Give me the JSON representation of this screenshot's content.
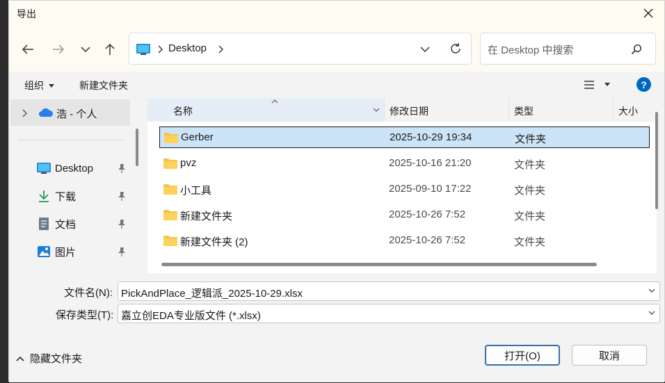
{
  "dialog": {
    "title": "导出"
  },
  "nav": {
    "breadcrumb": [
      "Desktop"
    ],
    "search_placeholder": "在 Desktop 中搜索"
  },
  "commands": {
    "organize": "组织",
    "new_folder": "新建文件夹"
  },
  "sidebar": {
    "cloud": "浩 - 个人",
    "items": [
      {
        "label": "Desktop",
        "icon": "desktop-icon"
      },
      {
        "label": "下载",
        "icon": "download-icon"
      },
      {
        "label": "文档",
        "icon": "document-icon"
      },
      {
        "label": "图片",
        "icon": "picture-icon"
      }
    ]
  },
  "columns": {
    "name": "名称",
    "modified": "修改日期",
    "type": "类型",
    "size": "大小"
  },
  "files": [
    {
      "name": "Gerber",
      "modified": "2025-10-29 19:34",
      "type": "文件夹",
      "selected": true
    },
    {
      "name": "pvz",
      "modified": "2025-10-16 21:20",
      "type": "文件夹"
    },
    {
      "name": "小工具",
      "modified": "2025-09-10 17:22",
      "type": "文件夹"
    },
    {
      "name": "新建文件夹",
      "modified": "2025-10-26 7:52",
      "type": "文件夹"
    },
    {
      "name": "新建文件夹 (2)",
      "modified": "2025-10-26 7:52",
      "type": "文件夹"
    }
  ],
  "form": {
    "filename_label": "文件名(N):",
    "filename_value": "PickAndPlace_逻辑派_2025-10-29.xlsx",
    "filetype_label": "保存类型(T):",
    "filetype_value": "嘉立创EDA专业版文件 (*.xlsx)"
  },
  "buttons": {
    "open": "打开(O)",
    "cancel": "取消",
    "hide_folders": "隐藏文件夹"
  },
  "colors": {
    "accent": "#0067c0",
    "selection": "#cce4f7",
    "folder": "#f5c445"
  }
}
